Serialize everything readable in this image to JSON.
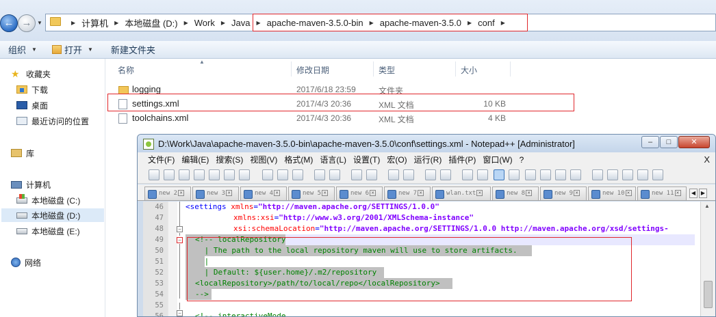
{
  "explorer": {
    "breadcrumbs": [
      "计算机",
      "本地磁盘 (D:)",
      "Work",
      "Java",
      "apache-maven-3.5.0-bin",
      "apache-maven-3.5.0",
      "conf"
    ],
    "toolbar": {
      "organize": "组织",
      "open": "打开",
      "new_folder": "新建文件夹"
    },
    "sidebar": {
      "favorites": "收藏夹",
      "downloads": "下载",
      "desktop": "桌面",
      "recent": "最近访问的位置",
      "libraries": "库",
      "computer": "计算机",
      "drive_c": "本地磁盘 (C:)",
      "drive_d": "本地磁盘 (D:)",
      "drive_e": "本地磁盘 (E:)",
      "network": "网络"
    },
    "columns": {
      "name": "名称",
      "modified": "修改日期",
      "type": "类型",
      "size": "大小"
    },
    "files": [
      {
        "name": "logging",
        "date": "2017/6/18 23:59",
        "type": "文件夹",
        "size": "",
        "kind": "folder"
      },
      {
        "name": "settings.xml",
        "date": "2017/4/3 20:36",
        "type": "XML 文档",
        "size": "10 KB",
        "kind": "file"
      },
      {
        "name": "toolchains.xml",
        "date": "2017/4/3 20:36",
        "type": "XML 文档",
        "size": "4 KB",
        "kind": "file"
      }
    ]
  },
  "notepad": {
    "title": "D:\\Work\\Java\\apache-maven-3.5.0-bin\\apache-maven-3.5.0\\conf\\settings.xml - Notepad++ [Administrator]",
    "menu": [
      "文件(F)",
      "编辑(E)",
      "搜索(S)",
      "视图(V)",
      "格式(M)",
      "语言(L)",
      "设置(T)",
      "宏(O)",
      "运行(R)",
      "插件(P)",
      "窗口(W)",
      "?"
    ],
    "menu_close": "X",
    "tabs": [
      "new 2",
      "new 3",
      "new 4",
      "new 5",
      "new 6",
      "new 7",
      "wlan.txt",
      "new 8",
      "new 9",
      "new 10",
      "new 11"
    ],
    "line_numbers": [
      "46",
      "47",
      "48",
      "49",
      "50",
      "51",
      "52",
      "53",
      "54",
      "55",
      "56"
    ],
    "code": {
      "l46_tag": "<settings ",
      "l46_attr": "xmlns",
      "l46_eq": "=",
      "l46_val": "\"http://maven.apache.org/SETTINGS/1.0.0\"",
      "l47_attr": "xmlns:xsi",
      "l47_eq": "=",
      "l47_val": "\"http://www.w3.org/2001/XMLSchema-instance\"",
      "l48_attr": "xsi:schemaLocation",
      "l48_eq": "=",
      "l48_val": "\"http://maven.apache.org/SETTINGS/1.0.0 http://maven.apache.org/xsd/settings-",
      "l49": "<!-- localRepository",
      "l50": " | The path to the local repository maven will use to store artifacts.",
      "l51": " |",
      "l52": " | Default: ${user.home}/.m2/repository",
      "l53": "<localRepository>/path/to/local/repo</localRepository>",
      "l54": "-->",
      "l56_tag": "<!-- interactiveMode"
    }
  }
}
